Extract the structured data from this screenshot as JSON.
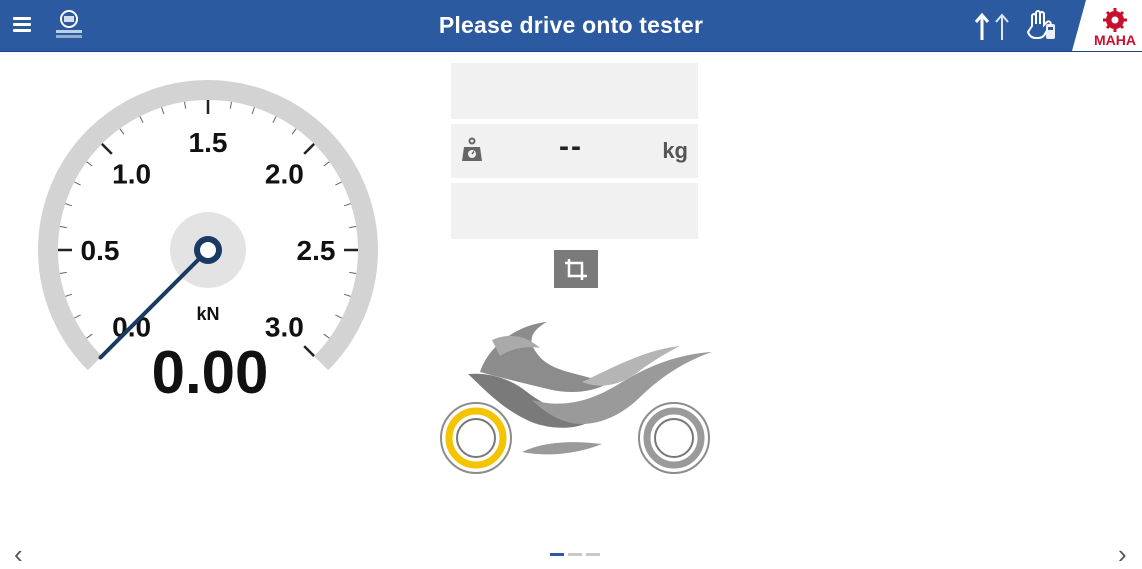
{
  "header": {
    "title": "Please drive onto tester",
    "menu_icon": "hamburger-menu-icon",
    "brand_logo_text": "MAHA"
  },
  "gauge": {
    "value": "0.00",
    "unit": "kN",
    "min": 0,
    "max": 3,
    "needle_value": 0,
    "tick_labels": [
      "0.0",
      "0.5",
      "1.0",
      "1.5",
      "2.0",
      "2.5",
      "3.0"
    ]
  },
  "weight_panel": {
    "value": "--",
    "unit": "kg",
    "icon": "weight-scale-icon"
  },
  "pager": {
    "pages": 3,
    "active_index": 0
  },
  "nav": {
    "prev": "‹",
    "next": "›"
  },
  "colors": {
    "header_bg": "#2c5aa0",
    "gauge_arc": "#d3d3d3",
    "needle": "#1b3a63",
    "front_wheel_ring": "#f5c400",
    "rear_wheel_ring": "#9a9a9a",
    "maha_red": "#c8102e"
  }
}
